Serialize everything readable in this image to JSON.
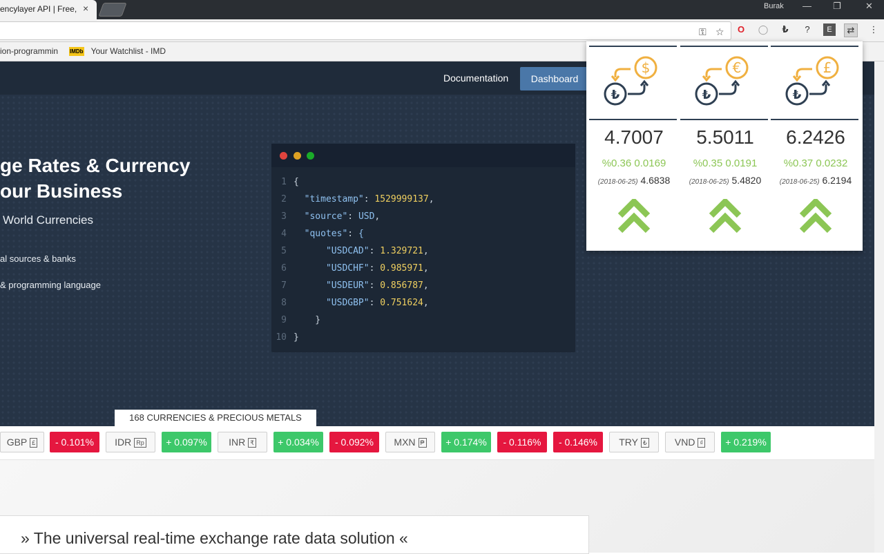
{
  "browser": {
    "tab_title": "encylayer API | Free, F",
    "tab_close": "×",
    "user_name": "Burak",
    "bookmarks": [
      "ion-programmin",
      "Your Watchlist - IMD"
    ],
    "imdb_badge": "IMDb"
  },
  "nav": {
    "documentation": "Documentation",
    "dashboard": "Dashboard"
  },
  "hero": {
    "headline_line1": "ge Rates & Currency",
    "headline_line2": "our Business",
    "subtitle": "World Currencies",
    "bullet1": "al sources & banks",
    "bullet2": "& programming language"
  },
  "code": {
    "lines": [
      {
        "n": "1",
        "text": "{"
      },
      {
        "n": "2",
        "key": "\"timestamp\"",
        "val": "1529999137",
        "tail": ","
      },
      {
        "n": "3",
        "key": "\"source\"",
        "val": "USD",
        "tail": ","
      },
      {
        "n": "4",
        "key": "\"quotes\"",
        "val": "{",
        "tail": ""
      },
      {
        "n": "5",
        "key": "\"USDCAD\"",
        "val": "1.329721",
        "tail": ","
      },
      {
        "n": "6",
        "key": "\"USDCHF\"",
        "val": "0.985971",
        "tail": ","
      },
      {
        "n": "7",
        "key": "\"USDEUR\"",
        "val": "0.856787",
        "tail": ","
      },
      {
        "n": "8",
        "key": "\"USDGBP\"",
        "val": "0.751624",
        "tail": ","
      },
      {
        "n": "9",
        "text": "    }"
      },
      {
        "n": "10",
        "text": "}"
      }
    ]
  },
  "ticker": {
    "tab_label": "168 CURRENCIES & PRECIOUS METALS",
    "gbp": "GBP",
    "gbp_sym": "£",
    "gbp_chg": "- 0.101%",
    "idr": "IDR",
    "idr_sym": "Rp",
    "idr_chg": "+ 0.097%",
    "inr": "INR",
    "inr_sym": "₹",
    "inr_chg": "+ 0.034%",
    "neg2": "- 0.092%",
    "mxn": "MXN",
    "mxn_sym": "₱",
    "mxn_chg": "+ 0.174%",
    "neg3": "- 0.116%",
    "neg4": "- 0.146%",
    "try": "TRY",
    "try_sym": "₺",
    "vnd": "VND",
    "vnd_sym": "₫",
    "vnd_chg": "+ 0.219%"
  },
  "tagline": "» The universal real-time exchange rate data solution «",
  "popup": {
    "usd": {
      "symbol": "$",
      "rate": "4.7007",
      "change": "%0.36 0.0169",
      "prev_date": "(2018-06-25)",
      "prev_rate": "4.6838"
    },
    "eur": {
      "symbol": "€",
      "rate": "5.5011",
      "change": "%0.35 0.0191",
      "prev_date": "(2018-06-25)",
      "prev_rate": "5.4820"
    },
    "gbp": {
      "symbol": "£",
      "rate": "6.2426",
      "change": "%0.37 0.0232",
      "prev_date": "(2018-06-25)",
      "prev_rate": "6.2194"
    },
    "base_symbol": "₺"
  },
  "colors": {
    "accent_green": "#8cc655",
    "negative_red": "#e5173f",
    "positive_green": "#3dc86a",
    "dashboard_blue": "#4a77a8",
    "coin_orange": "#f0b040",
    "coin_navy": "#2e3f52"
  }
}
